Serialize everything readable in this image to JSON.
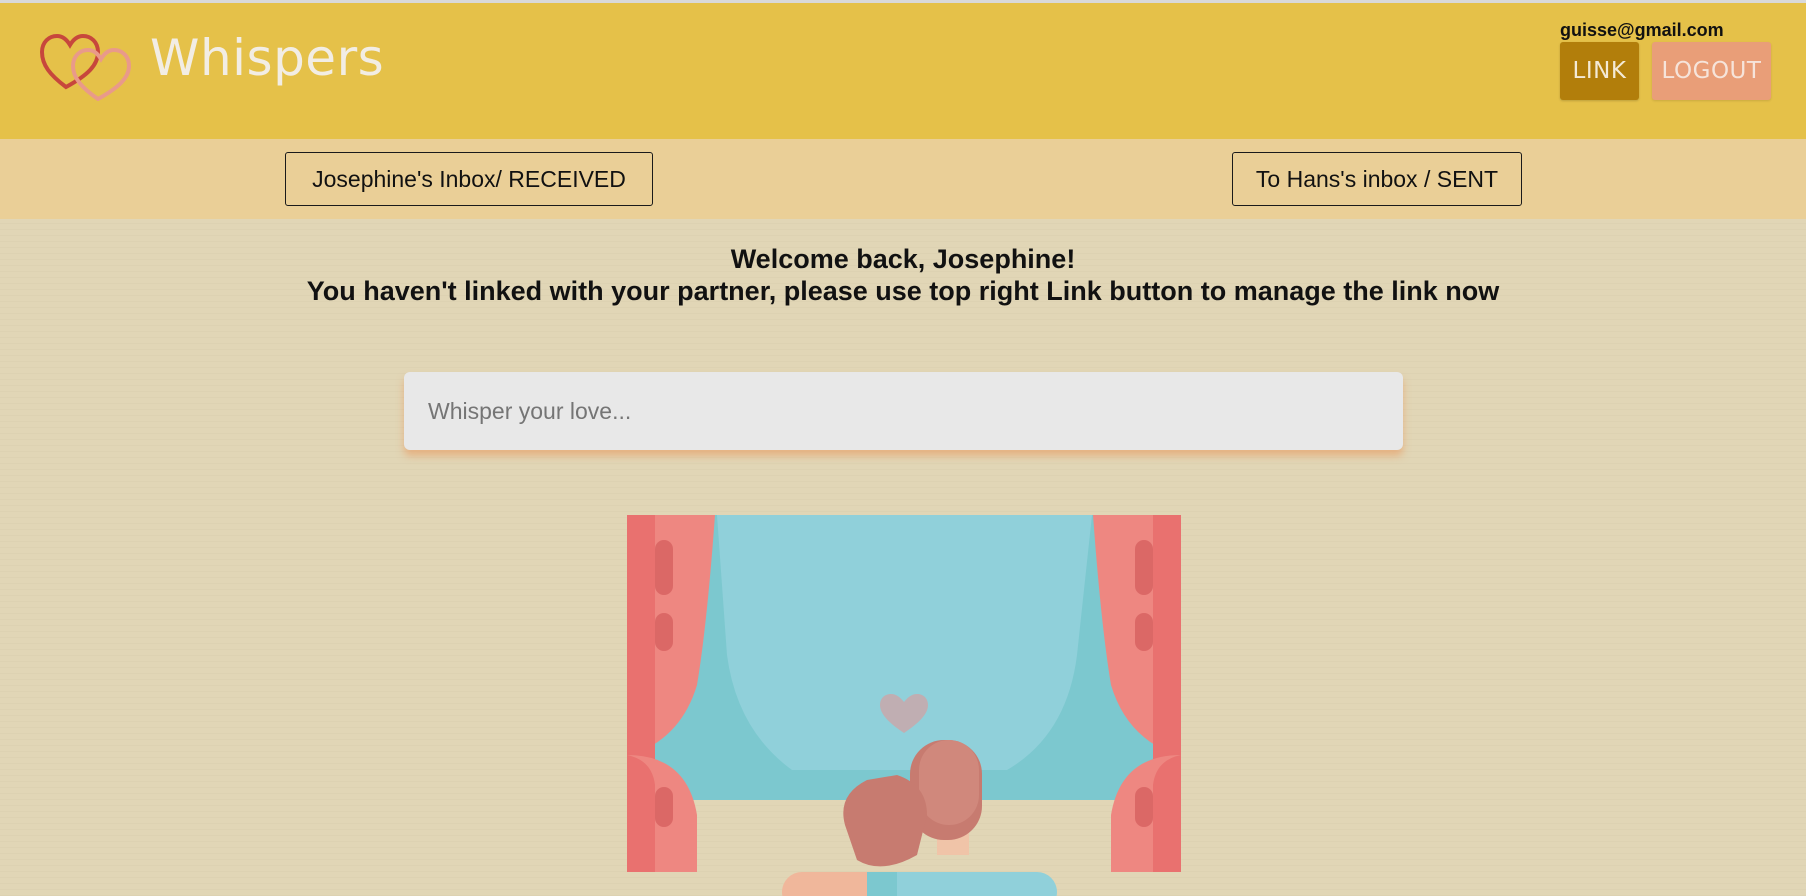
{
  "app": {
    "brand": "Whispers",
    "user_email": "guisse@gmail.com"
  },
  "header": {
    "link_label": "LINK",
    "logout_label": "LOGOUT"
  },
  "tabs": {
    "received_label": "Josephine's Inbox/ RECEIVED",
    "sent_label": "To Hans's inbox / SENT"
  },
  "main": {
    "welcome_line": "Welcome back, Josephine!",
    "link_notice": "You haven't linked with your partner, please use top right Link button to manage the link now",
    "whisper_placeholder": "Whisper your love...",
    "whisper_value": ""
  },
  "colors": {
    "header_bg": "#e5c149",
    "subnav_bg": "#eacf97",
    "page_bg": "#e1d6b6",
    "link_button": "#b27e0b",
    "logout_button": "#e99e78"
  },
  "icons": {
    "logo": "double-hearts-icon",
    "illustration": "couple-window-curtains-illustration"
  }
}
